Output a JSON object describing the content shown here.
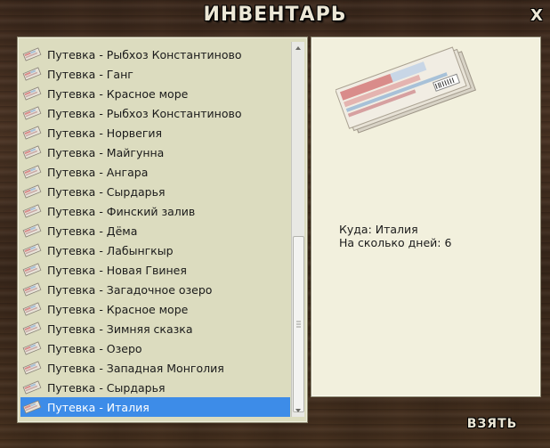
{
  "window": {
    "title": "ИНВЕНТАРЬ",
    "close_label": "X"
  },
  "inventory": {
    "items": [
      {
        "label": "Путевка - Рыбхоз Константиново",
        "icon": "ticket-icon"
      },
      {
        "label": "Путевка - Ганг",
        "icon": "ticket-icon"
      },
      {
        "label": "Путевка - Красное море",
        "icon": "ticket-icon"
      },
      {
        "label": "Путевка - Рыбхоз Константиново",
        "icon": "ticket-icon"
      },
      {
        "label": "Путевка - Норвегия",
        "icon": "ticket-icon"
      },
      {
        "label": "Путевка - Майгунна",
        "icon": "ticket-icon"
      },
      {
        "label": "Путевка - Ангара",
        "icon": "ticket-icon"
      },
      {
        "label": "Путевка - Сырдарья",
        "icon": "ticket-icon"
      },
      {
        "label": "Путевка - Финский залив",
        "icon": "ticket-icon"
      },
      {
        "label": "Путевка - Дёма",
        "icon": "ticket-icon"
      },
      {
        "label": "Путевка - Лабынгкыр",
        "icon": "ticket-icon"
      },
      {
        "label": "Путевка - Новая Гвинея",
        "icon": "ticket-icon"
      },
      {
        "label": "Путевка - Загадочное озеро",
        "icon": "ticket-icon"
      },
      {
        "label": "Путевка - Красное море",
        "icon": "ticket-icon"
      },
      {
        "label": "Путевка - Зимняя сказка",
        "icon": "ticket-icon"
      },
      {
        "label": "Путевка - Озеро",
        "icon": "ticket-icon"
      },
      {
        "label": "Путевка - Западная Монголия",
        "icon": "ticket-icon"
      },
      {
        "label": "Путевка - Сырдарья",
        "icon": "ticket-icon"
      },
      {
        "label": "Путевка - Италия",
        "icon": "ticket-icon",
        "selected": true
      }
    ]
  },
  "details": {
    "image_icon": "ticket-bundle-icon",
    "destination": "Куда: Италия",
    "days": "На сколько дней: 6"
  },
  "actions": {
    "take_label": "ВЗЯТЬ"
  },
  "colors": {
    "selection": "#3d8ce8",
    "panel": "#dcdcbf",
    "detail_panel": "#f2f0dd"
  }
}
